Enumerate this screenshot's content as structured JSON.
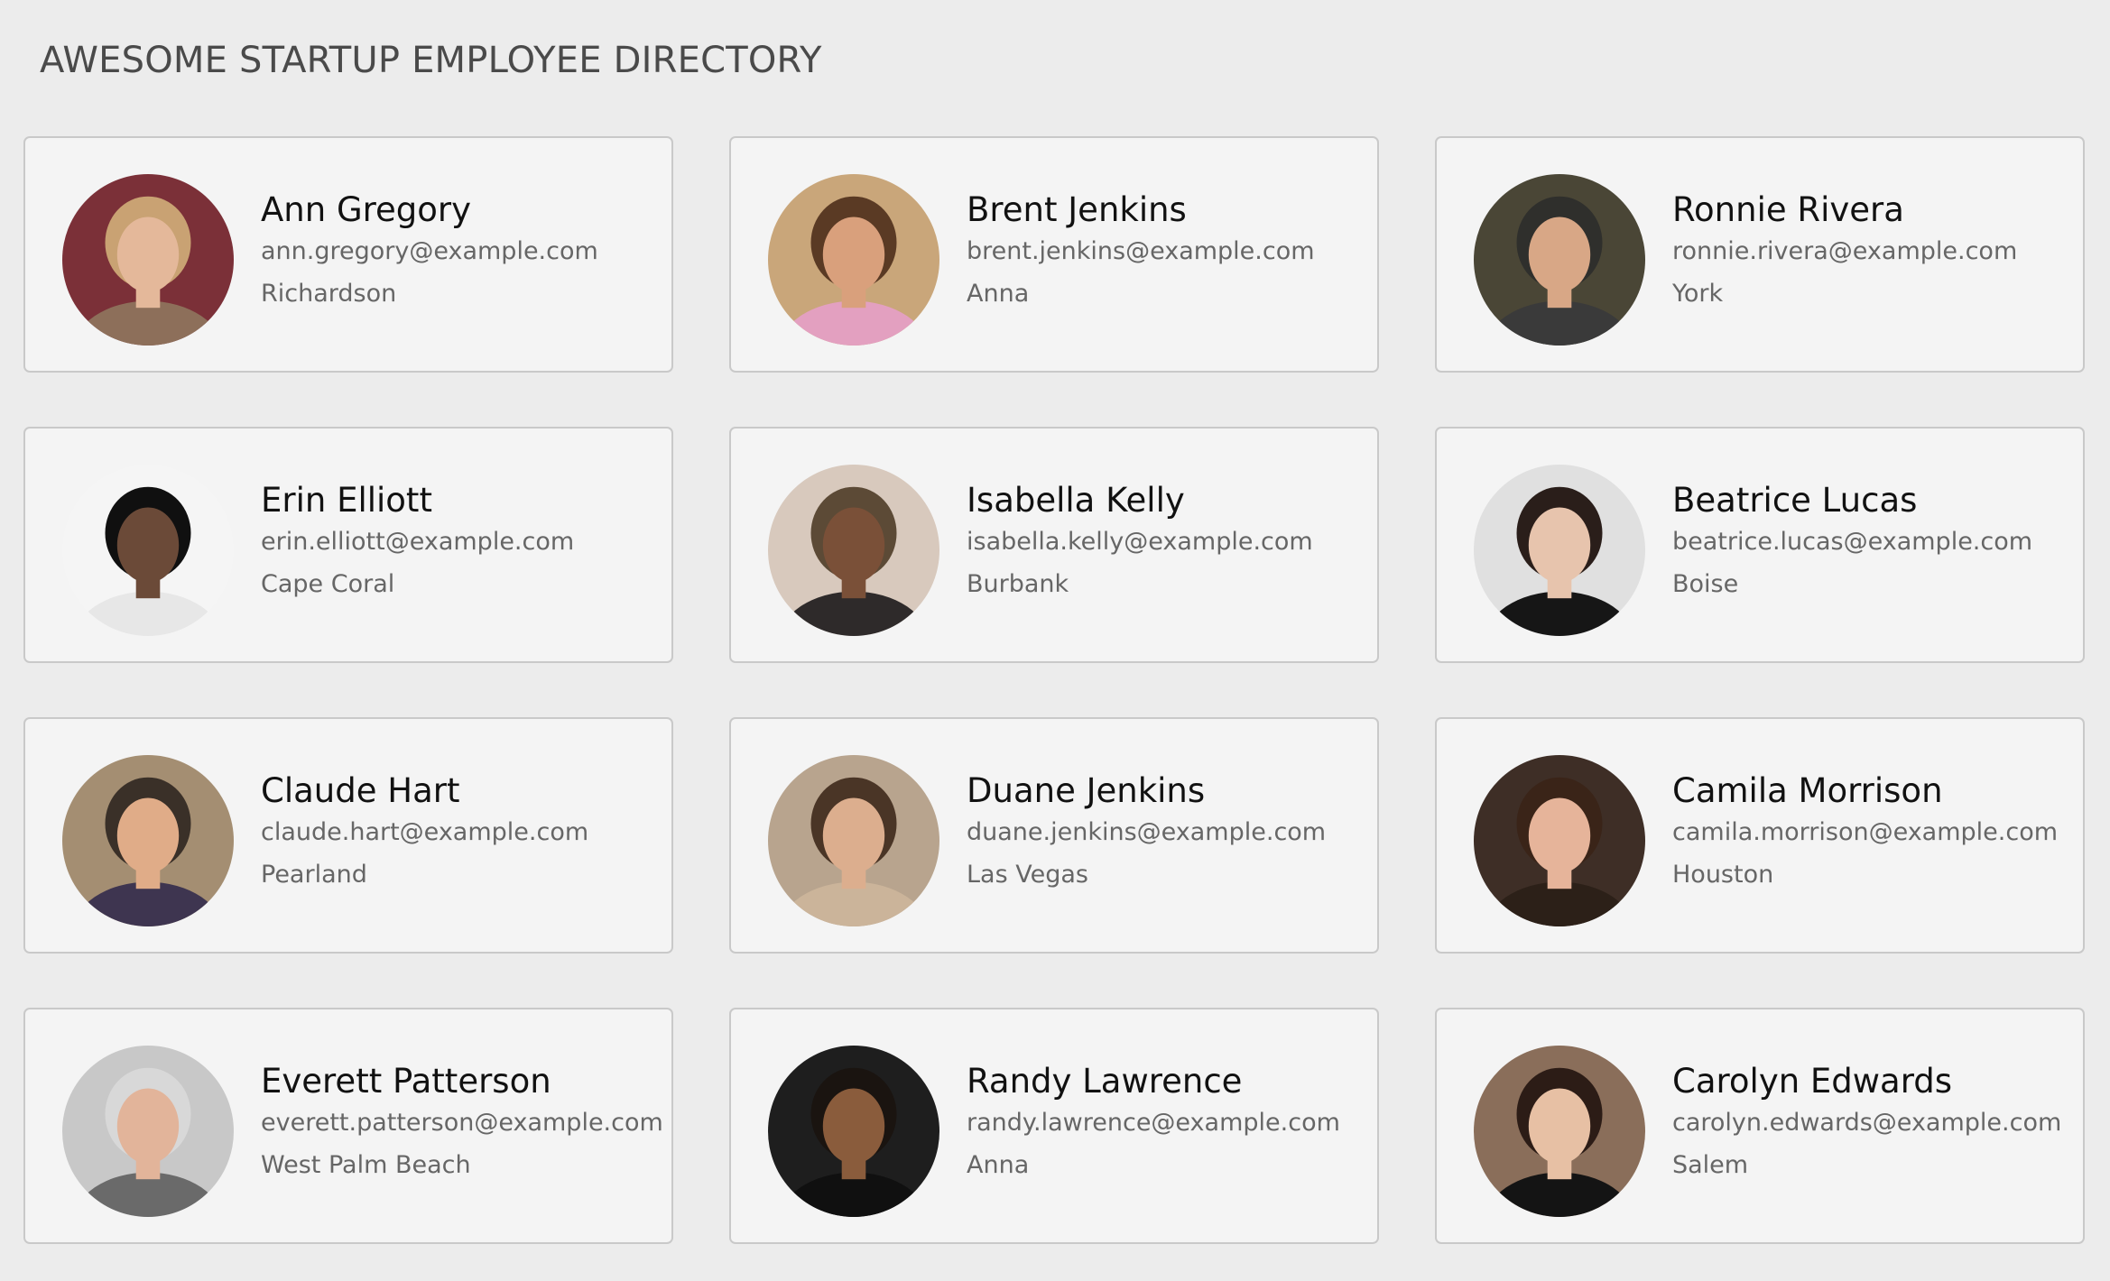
{
  "directory": {
    "title": "AWESOME STARTUP EMPLOYEE DIRECTORY"
  },
  "employees": [
    {
      "name": "Ann Gregory",
      "email": "ann.gregory@example.com",
      "city": "Richardson",
      "photo": {
        "bg": "#7b3038",
        "skin": "#e4b89a",
        "hair": "#c9a273",
        "shirt": "#8d6f5a"
      }
    },
    {
      "name": "Brent Jenkins",
      "email": "brent.jenkins@example.com",
      "city": "Anna",
      "photo": {
        "bg": "#c9a67a",
        "skin": "#d9a07c",
        "hair": "#5a3a24",
        "shirt": "#e3a0c0"
      }
    },
    {
      "name": "Ronnie Rivera",
      "email": "ronnie.rivera@example.com",
      "city": "York",
      "photo": {
        "bg": "#4a4636",
        "skin": "#d8a786",
        "hair": "#2f2f2c",
        "shirt": "#3a3a3a"
      }
    },
    {
      "name": "Erin Elliott",
      "email": "erin.elliott@example.com",
      "city": "Cape Coral",
      "photo": {
        "bg": "#f5f5f5",
        "skin": "#6b4a38",
        "hair": "#101010",
        "shirt": "#e7e7e7"
      }
    },
    {
      "name": "Isabella Kelly",
      "email": "isabella.kelly@example.com",
      "city": "Burbank",
      "photo": {
        "bg": "#d8c9bd",
        "skin": "#7a5038",
        "hair": "#5c4a36",
        "shirt": "#2e2a2a"
      }
    },
    {
      "name": "Beatrice Lucas",
      "email": "beatrice.lucas@example.com",
      "city": "Boise",
      "photo": {
        "bg": "#e0e0e0",
        "skin": "#e7c4ad",
        "hair": "#2a1e1a",
        "shirt": "#161616"
      }
    },
    {
      "name": "Claude Hart",
      "email": "claude.hart@example.com",
      "city": "Pearland",
      "photo": {
        "bg": "#a48e72",
        "skin": "#e0ac88",
        "hair": "#3a3028",
        "shirt": "#3e3550"
      }
    },
    {
      "name": "Duane Jenkins",
      "email": "duane.jenkins@example.com",
      "city": "Las Vegas",
      "photo": {
        "bg": "#b8a48e",
        "skin": "#dcae8e",
        "hair": "#4a3526",
        "shirt": "#cbb49a"
      }
    },
    {
      "name": "Camila Morrison",
      "email": "camila.morrison@example.com",
      "city": "Houston",
      "photo": {
        "bg": "#3e2e26",
        "skin": "#e6b49a",
        "hair": "#3a2418",
        "shirt": "#2c2018"
      }
    },
    {
      "name": "Everett Patterson",
      "email": "everett.patterson@example.com",
      "city": "West Palm Beach",
      "photo": {
        "bg": "#c8c8c8",
        "skin": "#e2b49a",
        "hair": "#d8d8d8",
        "shirt": "#6a6a6a"
      }
    },
    {
      "name": "Randy Lawrence",
      "email": "randy.lawrence@example.com",
      "city": "Anna",
      "photo": {
        "bg": "#1e1e1e",
        "skin": "#8a5c3c",
        "hair": "#1a1410",
        "shirt": "#101010"
      }
    },
    {
      "name": "Carolyn Edwards",
      "email": "carolyn.edwards@example.com",
      "city": "Salem",
      "photo": {
        "bg": "#8a6e5a",
        "skin": "#e7c0a4",
        "hair": "#2c1c16",
        "shirt": "#141414"
      }
    }
  ]
}
